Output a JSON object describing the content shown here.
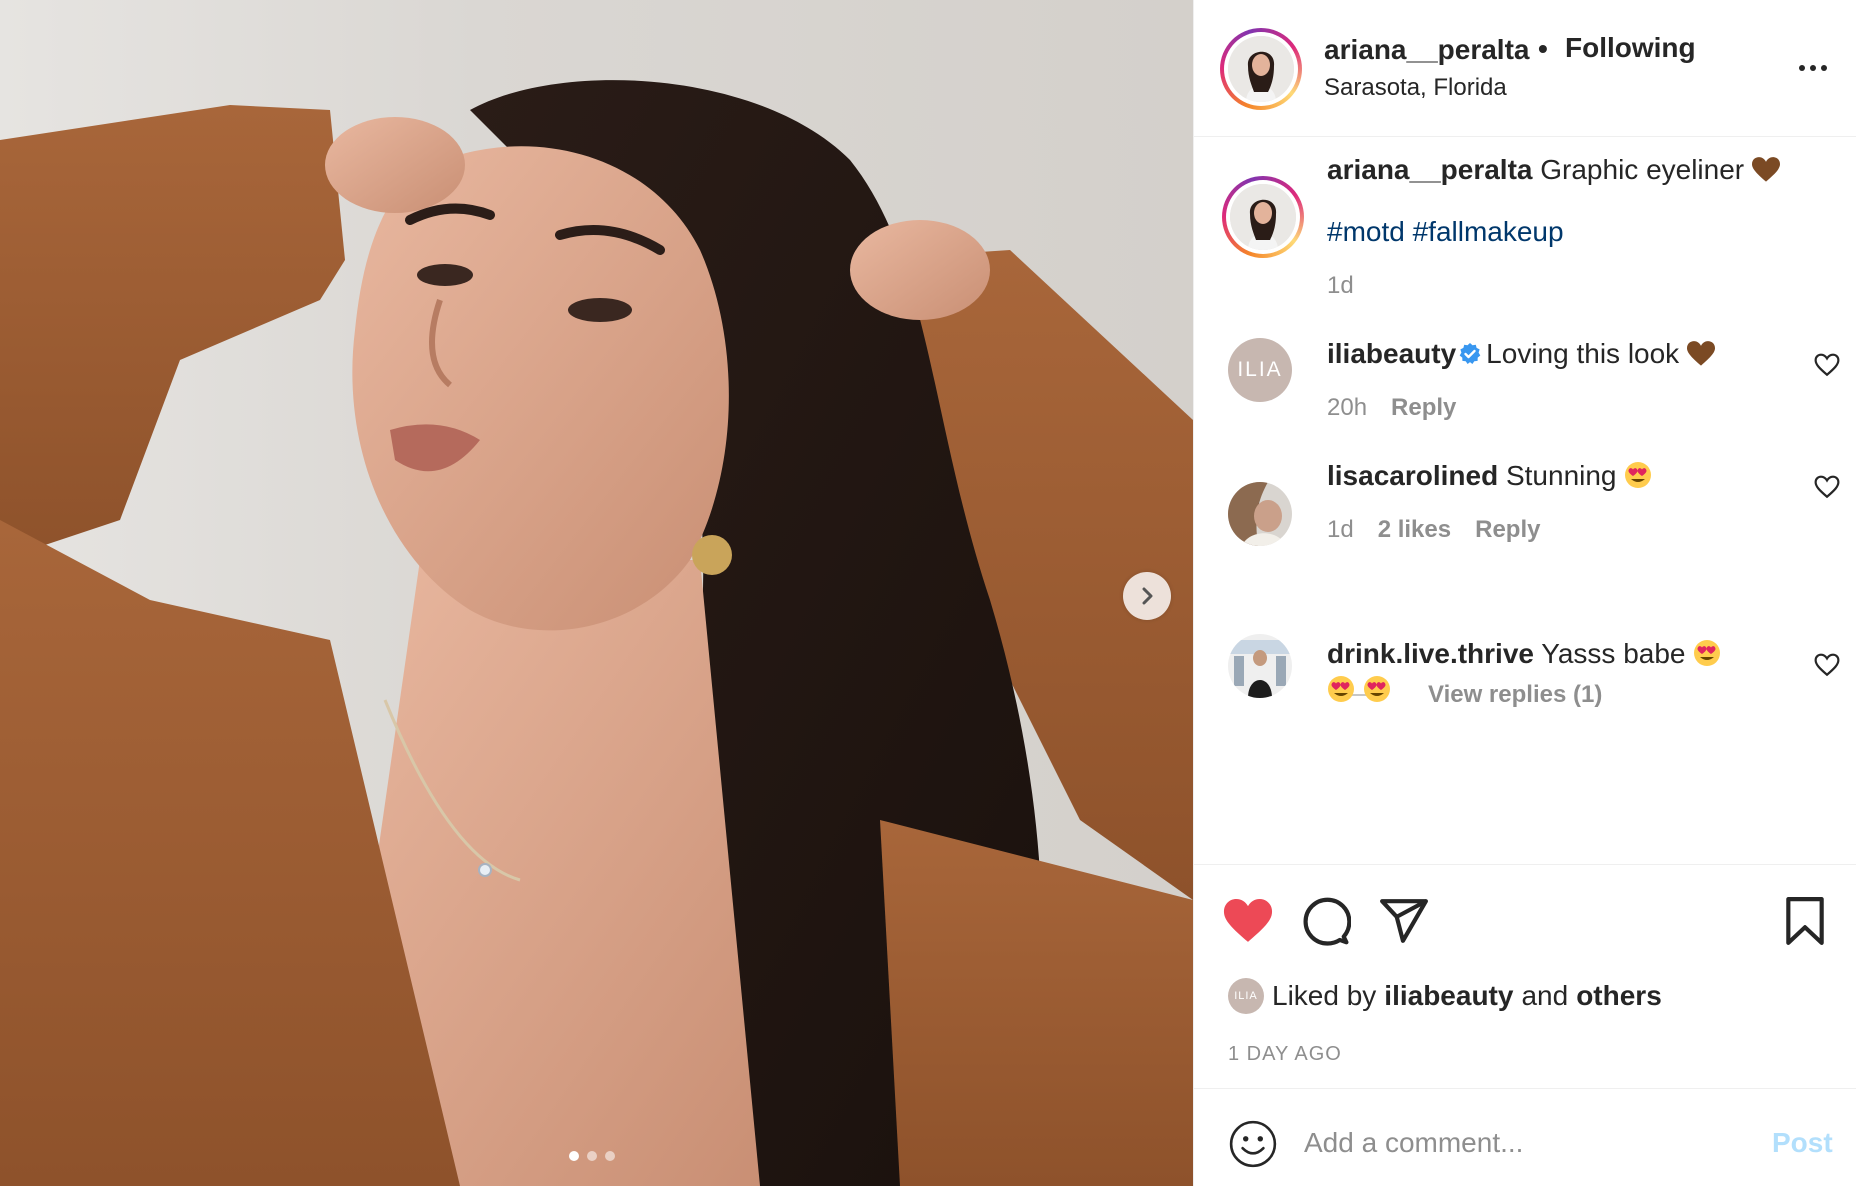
{
  "colors": {
    "accent": "#0095f6",
    "post_disabled": "#b2dffc",
    "like_red": "#ed4956",
    "hashtag": "#00376b",
    "muted": "#8e8e8e",
    "text": "#262626"
  },
  "photo": {
    "carousel_total": 3,
    "carousel_active": 1,
    "next_icon": "chevron-right-icon"
  },
  "header": {
    "username": "ariana__peralta",
    "separator": "•",
    "follow_status": "Following",
    "location": "Sarasota, Florida",
    "more_icon": "more-options-icon"
  },
  "caption": {
    "username": "ariana__peralta",
    "text": "Graphic eyeliner",
    "emoji": "brown-heart",
    "hashtags": "#motd #fallmakeup",
    "time": "1d"
  },
  "comments": [
    {
      "avatar_text": "ILIA",
      "username": "iliabeauty",
      "verified": true,
      "text": "Loving this look",
      "emoji": "brown-heart",
      "time": "20h",
      "reply_label": "Reply"
    },
    {
      "username": "lisacarolined",
      "text": "Stunning",
      "emoji": "heart-eyes",
      "time": "1d",
      "likes": "2 likes",
      "reply_label": "Reply",
      "view_replies": "View replies (1)"
    },
    {
      "username": "drink.live.thrive",
      "text": "Yasss babe",
      "emoji": "heart-eyes"
    }
  ],
  "actions": {
    "liked": true,
    "liked_by_prefix": "Liked by",
    "liked_by_user": "iliabeauty",
    "liked_by_and": "and",
    "liked_by_others": "others",
    "mini_avatar_text": "ILIA",
    "time_ago": "1 DAY AGO"
  },
  "add_comment": {
    "placeholder": "Add a comment...",
    "post_label": "Post"
  }
}
